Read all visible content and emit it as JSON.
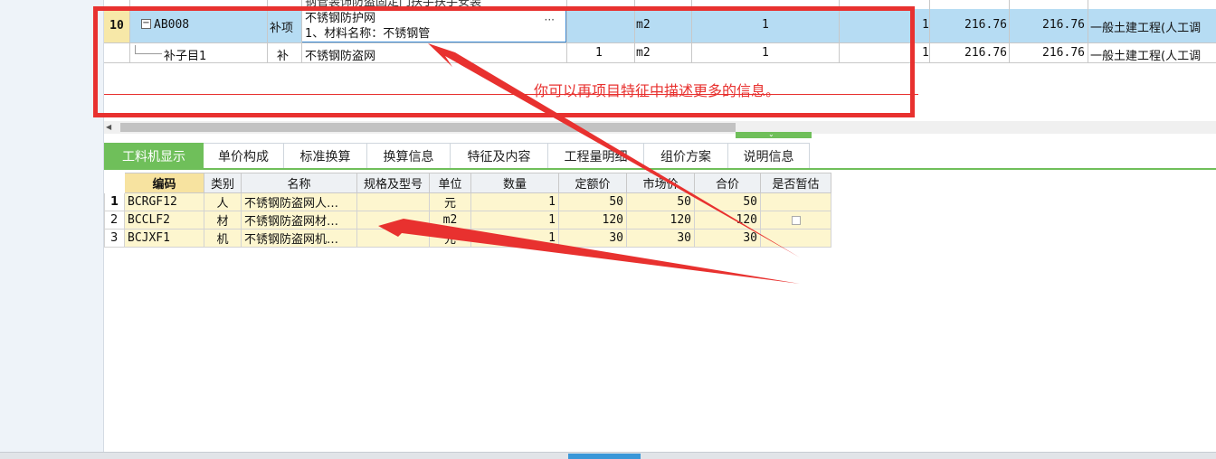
{
  "upper_table": {
    "top_row_text": "钢管装饰防盗固定门扶手扶手安装",
    "row10": {
      "number": "10",
      "expand": "−",
      "code": "AB008",
      "type": "补项",
      "name_line1": "不锈钢防护网",
      "name_line2": "1、材料名称：不锈钢管",
      "ellipsis": "···",
      "unit": "m2",
      "quantity": "1",
      "qty_extra": "1",
      "price": "216.76",
      "total": "216.76",
      "category": "一般土建工程(人工调"
    },
    "sub_row": {
      "code": "补子目1",
      "type": "补",
      "name": "不锈钢防盗网",
      "expr": "1",
      "unit": "m2",
      "quantity": "1",
      "qty_extra": "1",
      "price": "216.76",
      "total": "216.76",
      "category": "一般土建工程(人工调"
    }
  },
  "annotation": {
    "hint": "你可以再项目特征中描述更多的信息。",
    "color": "#e8312f"
  },
  "tabs": [
    {
      "label": "工料机显示",
      "active": true
    },
    {
      "label": "单价构成"
    },
    {
      "label": "标准换算"
    },
    {
      "label": "换算信息"
    },
    {
      "label": "特征及内容"
    },
    {
      "label": "工程量明细"
    },
    {
      "label": "组价方案"
    },
    {
      "label": "说明信息"
    }
  ],
  "lower_grid": {
    "headers": [
      "编码",
      "类别",
      "名称",
      "规格及型号",
      "单位",
      "数量",
      "定额价",
      "市场价",
      "合价",
      "是否暂估"
    ],
    "rows": [
      {
        "n": "1",
        "code": "BCRGF12",
        "kind": "人",
        "name": "不锈钢防盗网人…",
        "spec": "",
        "unit": "元",
        "qty": "1",
        "base": "50",
        "market": "50",
        "total": "50"
      },
      {
        "n": "2",
        "code": "BCCLF2",
        "kind": "材",
        "name": "不锈钢防盗网材…",
        "spec": "",
        "unit": "m2",
        "qty": "1",
        "base": "120",
        "market": "120",
        "total": "120"
      },
      {
        "n": "3",
        "code": "BCJXF1",
        "kind": "机",
        "name": "不锈钢防盗网机…",
        "spec": "",
        "unit": "元",
        "qty": "1",
        "base": "30",
        "market": "30",
        "total": "30"
      }
    ]
  },
  "colors": {
    "accent_green": "#6fbf5a",
    "selected_row": "#b6dcf3",
    "grid_cell": "#fdf6cf"
  }
}
